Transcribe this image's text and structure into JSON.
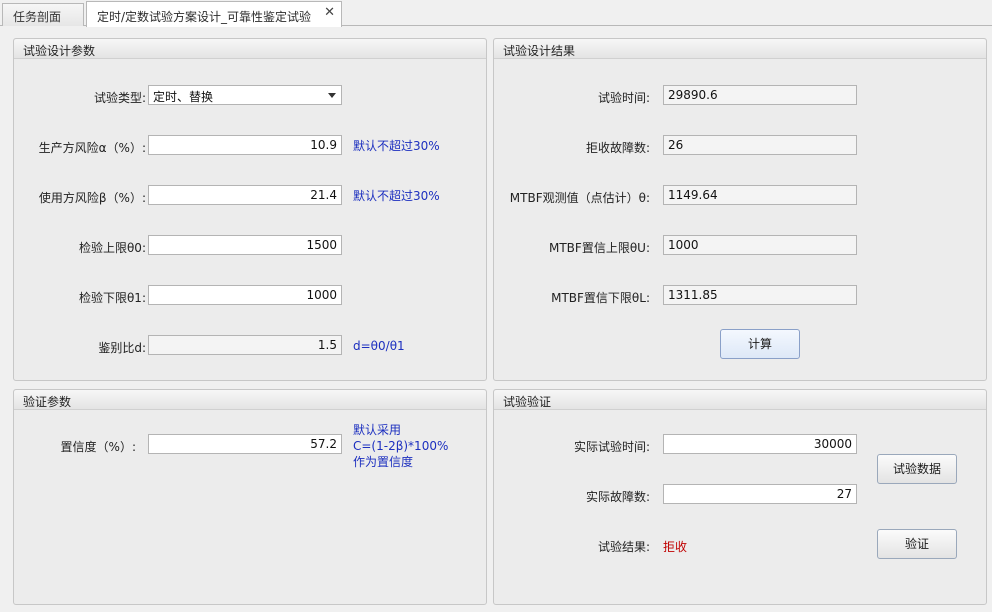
{
  "tabs": [
    {
      "label": "任务剖面"
    },
    {
      "label": "定时/定数试验方案设计_可靠性鉴定试验"
    }
  ],
  "design_params": {
    "title": "试验设计参数",
    "test_type_label": "试验类型:",
    "test_type_value": "定时、替换",
    "producer_risk_label": "生产方风险α（%）:",
    "producer_risk_value": "10.9",
    "producer_risk_hint": "默认不超过30%",
    "user_risk_label": "使用方风险β（%）:",
    "user_risk_value": "21.4",
    "user_risk_hint": "默认不超过30%",
    "upper_limit_label": "检验上限θ0:",
    "upper_limit_value": "1500",
    "lower_limit_label": "检验下限θ1:",
    "lower_limit_value": "1000",
    "discrimination_label": "鉴别比d:",
    "discrimination_value": "1.5",
    "discrimination_hint": "d=θ0/θ1"
  },
  "design_results": {
    "title": "试验设计结果",
    "test_time_label": "试验时间:",
    "test_time_value": "29890.6",
    "reject_failures_label": "拒收故障数:",
    "reject_failures_value": "26",
    "mtbf_obs_label": "MTBF观测值（点估计）θ:",
    "mtbf_obs_value": "1149.64",
    "mtbf_upper_label": "MTBF置信上限θU:",
    "mtbf_upper_value": "1000",
    "mtbf_lower_label": "MTBF置信下限θL:",
    "mtbf_lower_value": "1311.85",
    "calc_button": "计算"
  },
  "verify_params": {
    "title": "验证参数",
    "confidence_label": "置信度（%）:",
    "confidence_value": "57.2",
    "confidence_hint_1": "默认采用",
    "confidence_hint_2": "C=(1-2β)*100%",
    "confidence_hint_3": "作为置信度"
  },
  "test_verify": {
    "title": "试验验证",
    "actual_time_label": "实际试验时间:",
    "actual_time_value": "30000",
    "actual_failures_label": "实际故障数:",
    "actual_failures_value": "27",
    "result_label": "试验结果:",
    "result_value": "拒收",
    "test_data_button": "试验数据",
    "verify_button": "验证"
  },
  "colors": {
    "hint": "#1c2fbf",
    "reject": "#c00000"
  }
}
